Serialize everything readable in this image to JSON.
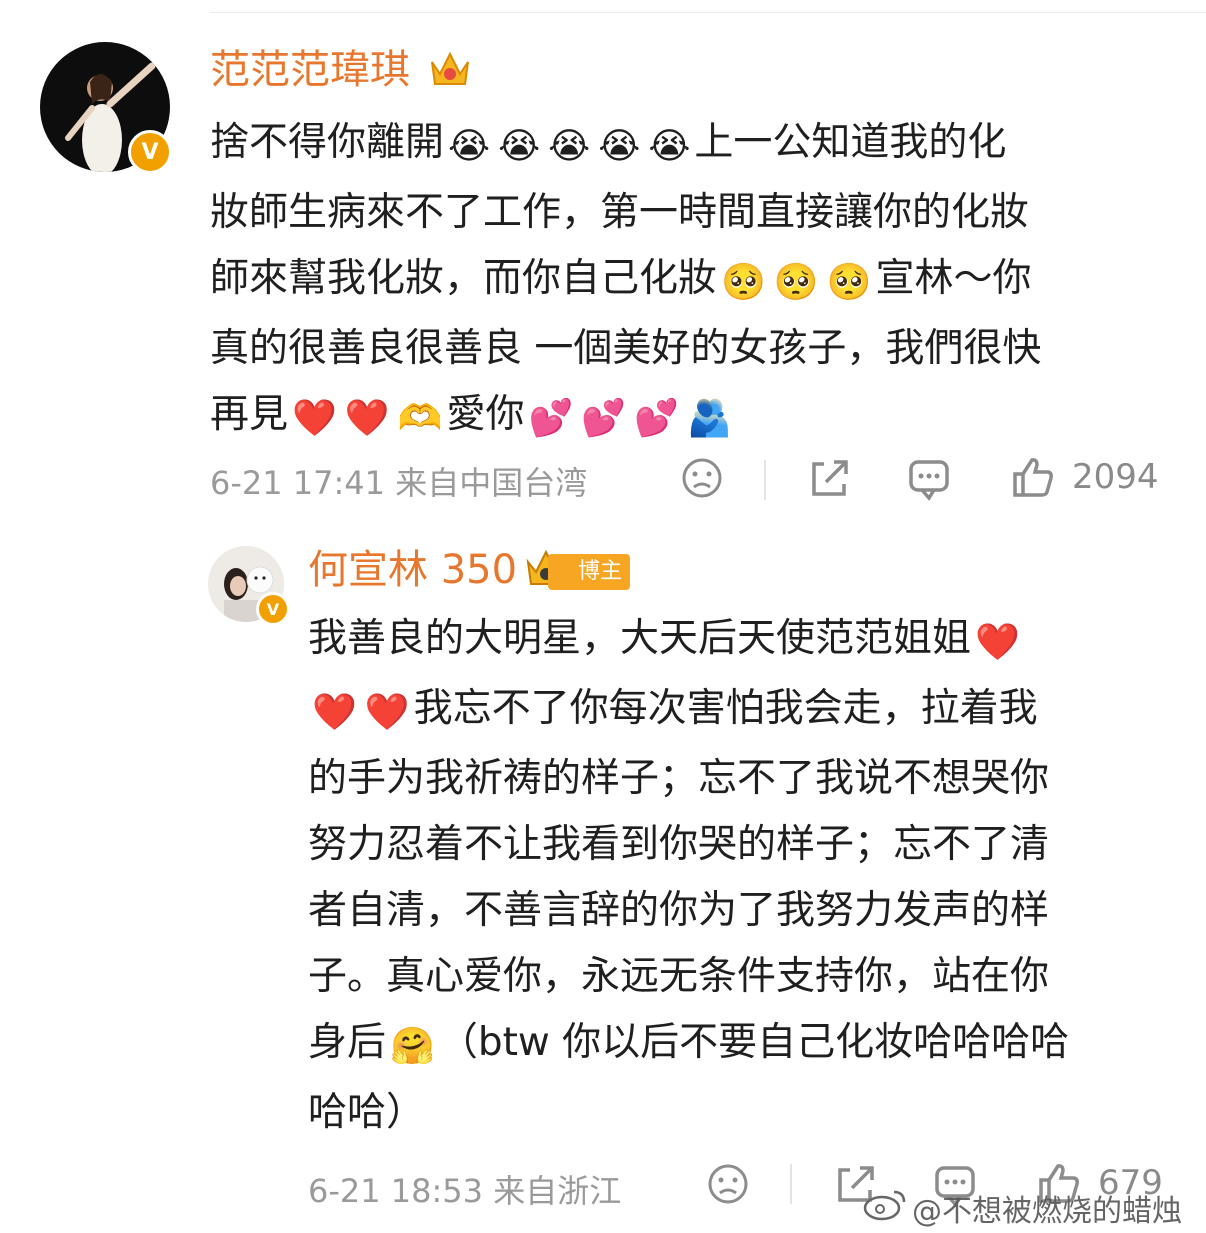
{
  "comment": {
    "username": "范范范瑋琪",
    "lines": [
      {
        "pre": "捨不得你離開",
        "emoji": [
          "😭",
          "😭",
          "😭",
          "😭",
          "😭"
        ],
        "post": "上一公知道我的化"
      },
      {
        "text": "妝師生病來不了工作，第一時間直接讓你的化妝"
      },
      {
        "pre": "師來幫我化妝，而你自己化妝",
        "emoji": [
          "🥺",
          "🥺",
          "🥺"
        ],
        "post": "宣林～你"
      },
      {
        "text": "真的很善良很善良 一個美好的女孩子，我們很快"
      },
      {
        "pre": "再見",
        "emoji": [
          "❤️",
          "❤️",
          "🫶"
        ],
        "post": "愛你",
        "emoji2": [
          "💕",
          "💕",
          "💕",
          "🫂"
        ]
      }
    ],
    "meta": "6-21 17:41 来自中国台湾",
    "likes": "2094",
    "icons": {
      "dislike": "sad-face-icon",
      "share": "share-icon",
      "comment": "comment-icon",
      "like": "thumbs-up-icon"
    }
  },
  "reply": {
    "username": "何宣林 350",
    "badge": "博主",
    "lines": [
      {
        "pre": "我善良的大明星，大天后天使范范姐姐",
        "emoji": [
          "❤️"
        ],
        "post": ""
      },
      {
        "pre": "",
        "emoji": [
          "❤️",
          "❤️"
        ],
        "post": "我忘不了你每次害怕我会走，拉着我"
      },
      {
        "text": "的手为我祈祷的样子；忘不了我说不想哭你"
      },
      {
        "text": "努力忍着不让我看到你哭的样子；忘不了清"
      },
      {
        "text": "者自清，不善言辞的你为了我努力发声的样"
      },
      {
        "text": "子。真心爱你，永远无条件支持你，站在你"
      },
      {
        "pre": "身后",
        "emoji": [
          "🤗"
        ],
        "post": "（btw 你以后不要自己化妆哈哈哈哈"
      },
      {
        "text": "哈哈）"
      }
    ],
    "meta": "6-21 18:53 来自浙江",
    "likes": "679"
  },
  "watermark": "@不想被燃烧的蜡烛",
  "colors": {
    "username": "#e8772e",
    "verified": "#f2a000",
    "heart": "#e0182e",
    "text": "#1f1f1f",
    "meta": "#9a9a9a"
  }
}
